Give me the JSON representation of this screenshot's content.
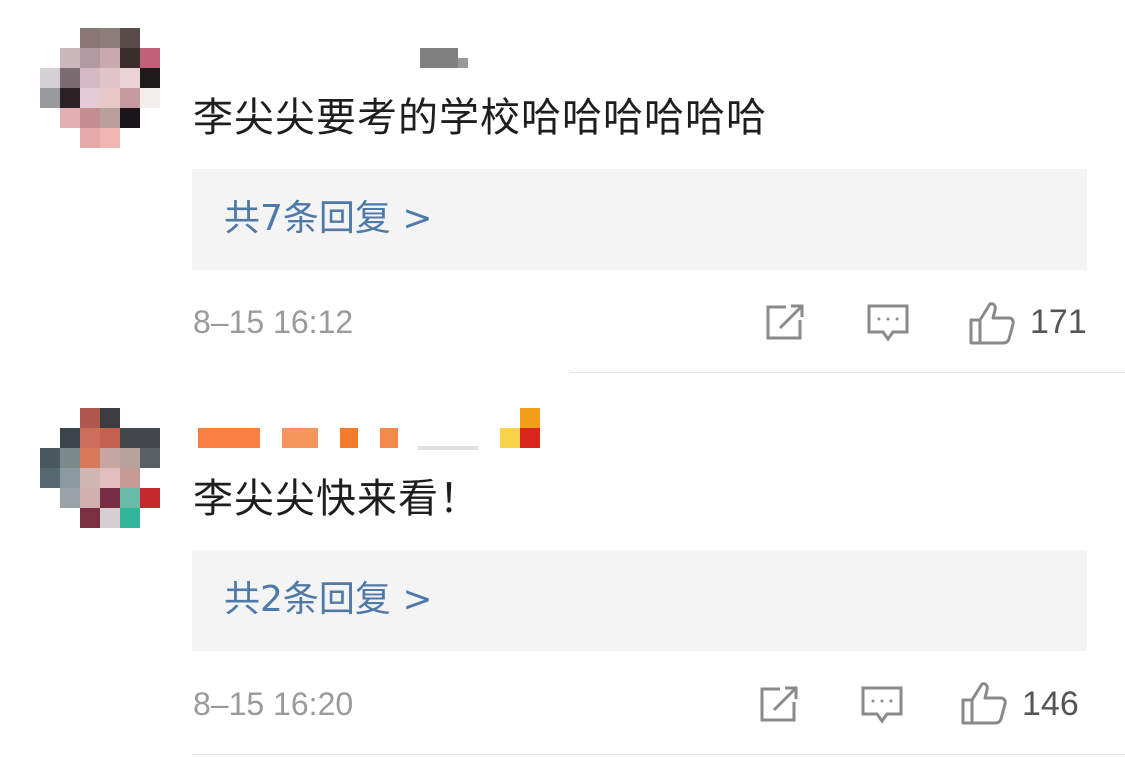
{
  "comments": [
    {
      "text": "李尖尖要考的学校哈哈哈哈哈哈",
      "reply_label": "共7条回复 >",
      "time": "8–15 16:12",
      "likes": "171",
      "icons": [
        "share-icon",
        "comment-icon",
        "like-icon"
      ]
    },
    {
      "text": "李尖尖快来看！",
      "reply_label": "共2条回复 >",
      "time": "8–15 16:20",
      "likes": "146",
      "icons": [
        "share-icon",
        "comment-icon",
        "like-icon"
      ]
    }
  ],
  "colors": {
    "link": "#4f7aa8",
    "reply_bg": "#f4f4f4",
    "meta_text": "#9a9a9a"
  }
}
